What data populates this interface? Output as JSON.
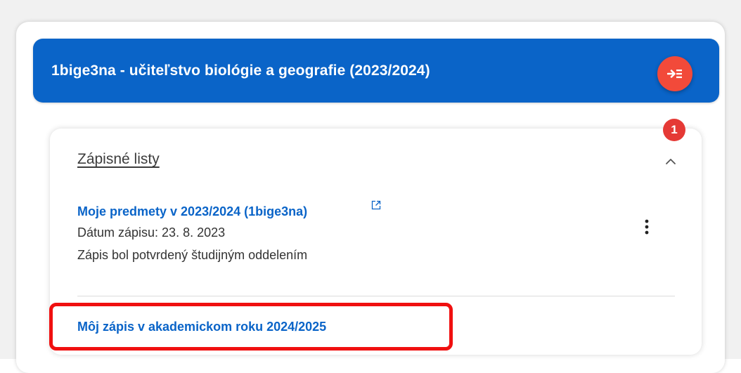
{
  "header": {
    "title": "1bige3na - učiteľstvo biológie a geografie (2023/2024)",
    "collapse_icon": "arrow-collapse-menu-icon"
  },
  "section": {
    "title": "Zápisné listy",
    "badge_count": "1",
    "expanded": true
  },
  "enrollment_item": {
    "link_label": "Moje predmety v 2023/2024 (1bige3na)",
    "date_line": "Dátum zápisu: 23. 8. 2023",
    "status_line": "Zápis bol potvrdený študijným oddelením"
  },
  "new_enrollment": {
    "link_label": "Môj zápis v akademickom roku 2024/2025",
    "highlighted": true
  },
  "colors": {
    "primary": "#0a64c8",
    "accent_button": "#f24a3a",
    "badge": "#e53935",
    "highlight": "#f01010"
  }
}
